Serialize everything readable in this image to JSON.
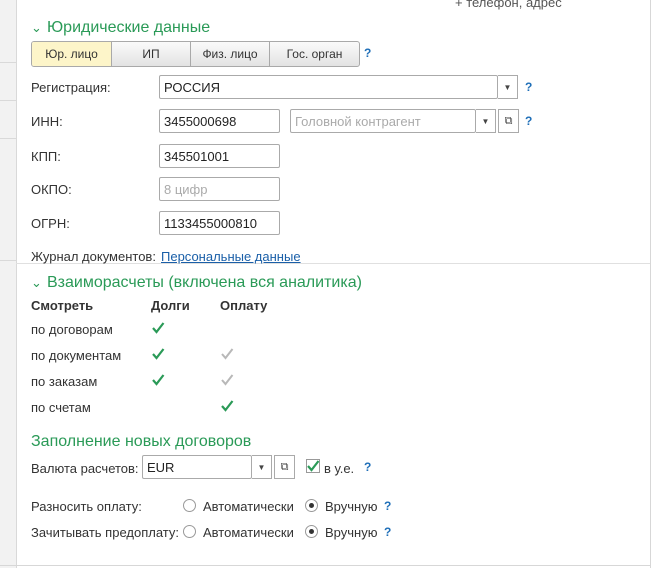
{
  "top_note": "+ телефон, адрес",
  "legal": {
    "title": "Юридические данные",
    "tabs": [
      {
        "label": "Юр. лицо",
        "active": true
      },
      {
        "label": "ИП",
        "active": false
      },
      {
        "label": "Физ. лицо",
        "active": false
      },
      {
        "label": "Гос. орган",
        "active": false
      }
    ],
    "help": "?",
    "registration": {
      "label": "Регистрация:",
      "value": "РОССИЯ"
    },
    "inn": {
      "label": "ИНН:",
      "value": "3455000698",
      "parent_placeholder": "Головной контрагент"
    },
    "kpp": {
      "label": "КПП:",
      "value": "345501001"
    },
    "okpo": {
      "label": "ОКПО:",
      "placeholder": "8 цифр"
    },
    "ogrn": {
      "label": "ОГРН:",
      "value": "1133455000810"
    },
    "journal": {
      "label": "Журнал документов:",
      "link": "Персональные данные"
    }
  },
  "settlements": {
    "title": "Взаиморасчеты (включена вся аналитика)",
    "headers": {
      "view": "Смотреть",
      "debts": "Долги",
      "payment": "Оплату"
    },
    "rows": [
      {
        "label": "по договорам",
        "debts": true,
        "payment": null
      },
      {
        "label": "по документам",
        "debts": true,
        "payment": "disabled"
      },
      {
        "label": "по заказам",
        "debts": true,
        "payment": "disabled"
      },
      {
        "label": "по счетам",
        "debts": null,
        "payment": true
      }
    ]
  },
  "new_contracts": {
    "title": "Заполнение новых договоров",
    "currency": {
      "label": "Валюта расчетов:",
      "value": "EUR",
      "in_units_label": "в у.е.",
      "in_units_checked": true
    },
    "distribute": {
      "label": "Разносить оплату:",
      "auto": "Автоматически",
      "manual": "Вручную",
      "selected": "manual"
    },
    "prepay": {
      "label": "Зачитывать предоплату:",
      "auto": "Автоматически",
      "manual": "Вручную",
      "selected": "manual"
    }
  },
  "colors": {
    "accent_green": "#2a9a57",
    "link_blue": "#1a5fa8",
    "active_tab": "#fdf5c9"
  },
  "icons": {
    "dropdown": "triangle-down",
    "open": "open-window-icon",
    "check": "check-mark",
    "collapse": "chevron-down"
  }
}
